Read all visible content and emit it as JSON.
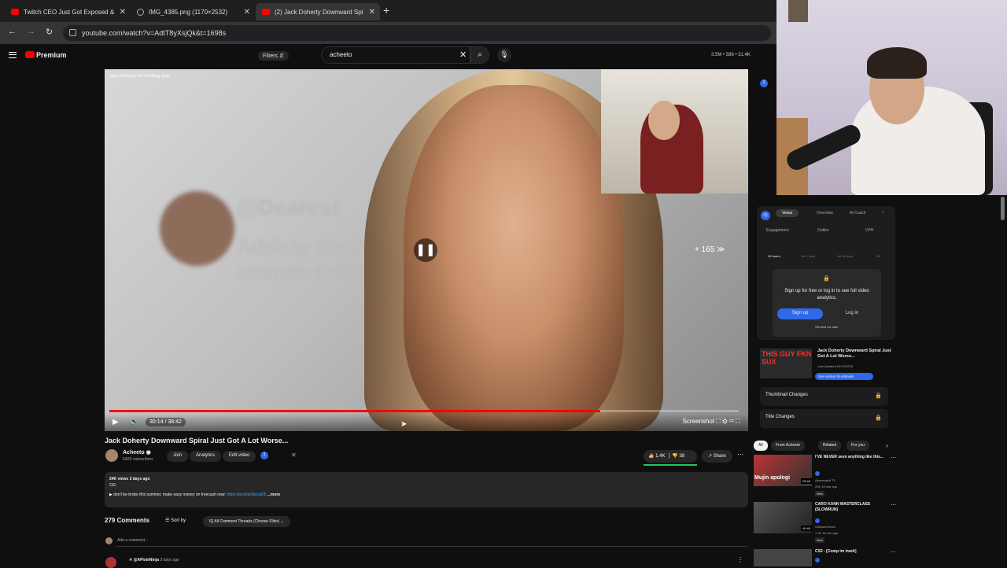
{
  "browser": {
    "tabs": [
      {
        "title": "Twitch CEO Just Got Exposed &",
        "icon": "youtube-icon"
      },
      {
        "title": "IMG_4385.png (1170×2532)",
        "icon": "image-icon"
      },
      {
        "title": "(2) Jack Doherty Downward Spi",
        "icon": "youtube-icon"
      }
    ],
    "url": "youtube.com/watch?v=AdtT8yXsjQk&t=1698s"
  },
  "youtube": {
    "brand": "Premium",
    "filters_label": "Filters",
    "search_value": "acheeto",
    "stats": "3.5M • 586 • 31.4K"
  },
  "video": {
    "caption": "Jack Doherty's Life is Falling Apart",
    "overlay_text1": "@Dearest",
    "overlay_text2": "Addicte          cted to",
    "overlay_text3": "attentio           rmination.",
    "skip_label": "+ 165",
    "time": "30:14 / 38:42",
    "progress_fraction": 0.78,
    "title": "Jack Doherty Downward Spiral Just Got A Lot Worse...",
    "controls_right": "Screenshot"
  },
  "channel": {
    "name": "Acheeto",
    "subscribers": "542K subscribers",
    "join": "Join",
    "analytics": "Analytics",
    "edit_video": "Edit video",
    "badge": "1",
    "likes": "1.4K",
    "dislikes": "38",
    "share": "Share"
  },
  "description": {
    "line1": "24K views  3 days ago",
    "line2": "OG:",
    "line3": "▶ don't be broke this summer, make easy money on freecash now:",
    "link": "https://pxl.link/8pcuEf6",
    "more": "...more"
  },
  "comments": {
    "count_label": "279 Comments",
    "sort_label": "Sort by",
    "threads_label": "All Comment Threads (Choose Filter)",
    "add_placeholder": "Add a comment...",
    "first_author": "@APixieNinja",
    "first_ago": "3 days ago"
  },
  "analytics_panel": {
    "tabs": [
      "Views",
      "Overview",
      "AI Coach"
    ],
    "metrics": [
      "Engagement",
      "Outlier",
      "VPH"
    ],
    "time_ranges": [
      "24 hours",
      "1st 7 days",
      "1st 28 days",
      "All"
    ],
    "signup_text": "Sign up for free or log in to see full video analytics.",
    "signup_btn": "Sign up",
    "login_btn": "Log in",
    "remind": "Remind me later",
    "thumb_text": "THIS GUY FKN SUX",
    "card_title": "Jack Doherty Downward Spiral Just Got A Lot Worse...",
    "card_sub": "Last Updated 04/13/2025",
    "card_btn": "See similar thumbnails",
    "thumbnail_changes": "Thumbnail Changes",
    "title_changes": "Title Changes"
  },
  "chips": [
    "All",
    "From Acheeto",
    "Related",
    "For you"
  ],
  "recommendations": [
    {
      "title": "I'VE NEVER seen anything like this...",
      "channel": "Asmongold TV",
      "meta": "20K  18 min ago",
      "tag": "New",
      "thumb_overlay": "Mujin apologi",
      "duration": "28:46"
    },
    {
      "title": "CARO KANN MASTERCLASS (SLOWRUN)",
      "channel": "GothamChess",
      "meta": "7.2K  16 min ago",
      "tag": "New",
      "thumb_overlay": "",
      "duration": "40:48"
    },
    {
      "title": "CS2 - [Comp im trash]",
      "channel": "",
      "meta": "",
      "tag": "",
      "thumb_overlay": "",
      "duration": ""
    }
  ]
}
